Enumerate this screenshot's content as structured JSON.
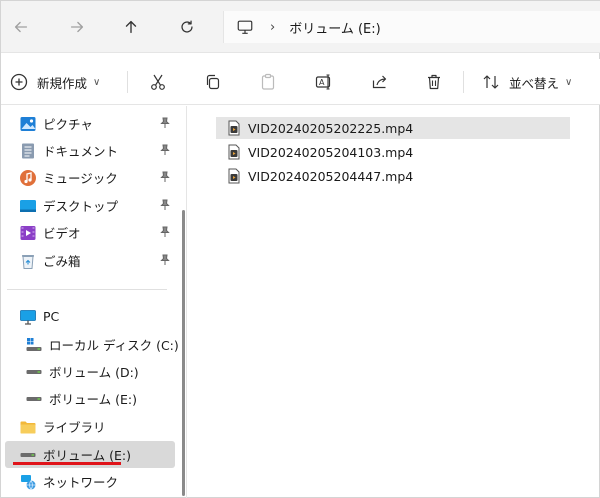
{
  "address": {
    "location": "ボリューム (E:)"
  },
  "toolbar": {
    "new_label": "新規作成",
    "sort_label": "並べ替え"
  },
  "sidebar": {
    "quick": [
      {
        "label": "ピクチャ",
        "icon": "pictures-icon"
      },
      {
        "label": "ドキュメント",
        "icon": "documents-icon"
      },
      {
        "label": "ミュージック",
        "icon": "music-icon"
      },
      {
        "label": "デスクトップ",
        "icon": "desktop-icon"
      },
      {
        "label": "ビデオ",
        "icon": "videos-icon"
      },
      {
        "label": "ごみ箱",
        "icon": "recycle-bin-icon"
      }
    ],
    "pc": {
      "label": "PC",
      "icon": "pc-icon"
    },
    "drives": [
      {
        "label": "ローカル ディスク (C:)",
        "icon": "local-disk-icon"
      },
      {
        "label": "ボリューム (D:)",
        "icon": "drive-icon"
      },
      {
        "label": "ボリューム (E:)",
        "icon": "drive-icon"
      }
    ],
    "libraries": {
      "label": "ライブラリ",
      "icon": "library-folder-icon"
    },
    "selected_volume": {
      "label": "ボリューム (E:)",
      "icon": "drive-icon"
    },
    "network": {
      "label": "ネットワーク",
      "icon": "network-icon"
    }
  },
  "files": [
    {
      "name": "VID20240205202225.mp4",
      "selected": true
    },
    {
      "name": "VID20240205204103.mp4",
      "selected": false
    },
    {
      "name": "VID20240205204447.mp4",
      "selected": false
    }
  ],
  "colors": {
    "accent_underline": "#e0141a",
    "selection": "#d9d9d9"
  }
}
